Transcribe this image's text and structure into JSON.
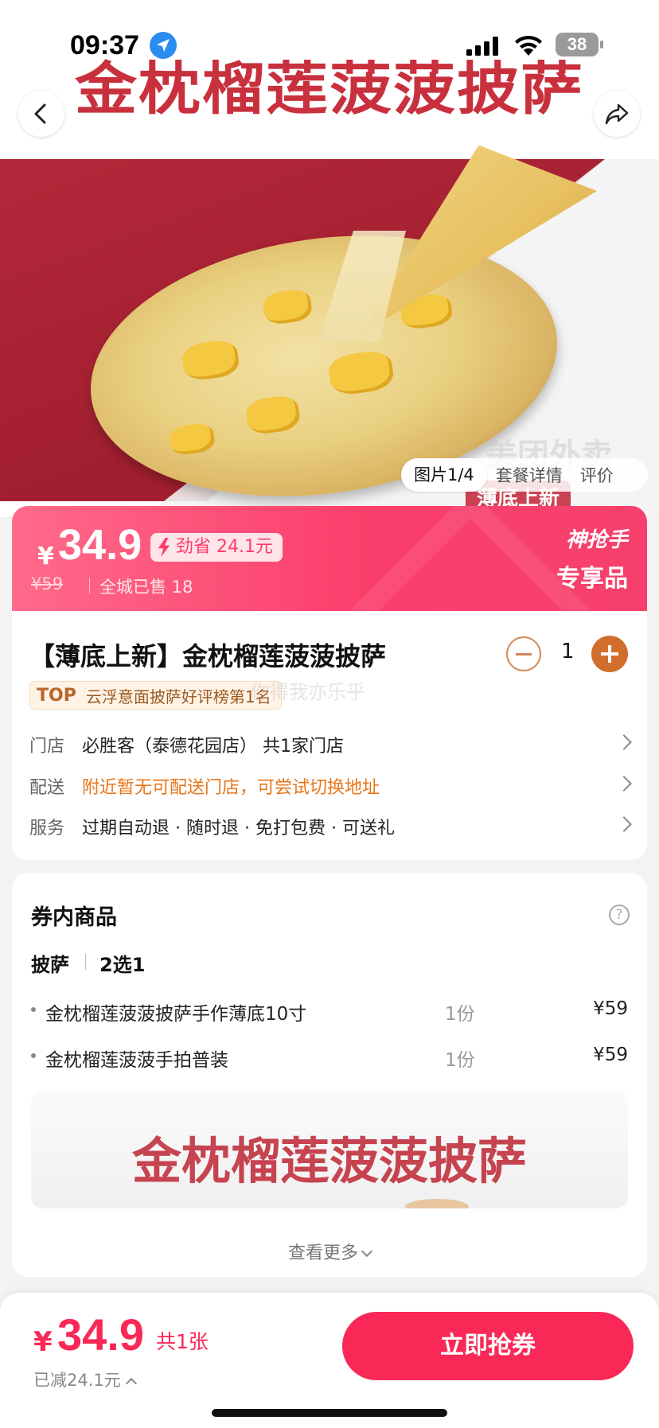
{
  "status_bar": {
    "time": "09:37",
    "battery": "38"
  },
  "hero": {
    "banner_title": "金枕榴莲菠菠披萨",
    "bottom_tag": "薄底上新",
    "watermark": "美团外卖",
    "tabs": [
      {
        "label": "图片1/4"
      },
      {
        "label": "套餐详情"
      },
      {
        "label": "评价"
      }
    ]
  },
  "price_banner": {
    "currency": "¥",
    "price": "34.9",
    "save": "劲省 24.1元",
    "original": "¥59",
    "sold": "全城已售 18",
    "badge_line1": "神抢手",
    "badge_line2": "专享品"
  },
  "product": {
    "title": "【薄底上新】金枕榴莲菠菠披萨",
    "quantity": "1",
    "rank_top": "TOP",
    "rank_text": "云浮意面披萨好评榜第1名",
    "watermark": "你得我亦乐乎",
    "rows": [
      {
        "label": "门店",
        "value": "必胜客（泰德花园店）  共1家门店"
      },
      {
        "label": "配送",
        "value": "附近暂无可配送门店，可尝试切换地址"
      },
      {
        "label": "服务",
        "value": "过期自动退 · 随时退 · 免打包费 · 可送礼"
      }
    ]
  },
  "coupon": {
    "title": "券内商品",
    "help": "?",
    "category": "披萨",
    "selection": "2选1",
    "items": [
      {
        "name": "金枕榴莲菠菠披萨手作薄底10寸",
        "count": "1份",
        "price": "¥59"
      },
      {
        "name": "金枕榴莲菠菠手拍普装",
        "count": "1份",
        "price": "¥59"
      }
    ],
    "preview_title": "金枕榴莲菠菠披萨",
    "more": "查看更多"
  },
  "bottom_bar": {
    "currency": "¥",
    "price": "34.9",
    "count": "共1张",
    "reduced": "已减24.1元",
    "buy_label": "立即抢券"
  },
  "colors": {
    "accent": "#fa2857",
    "warn": "#e8761a",
    "qty": "#d16e2e"
  }
}
